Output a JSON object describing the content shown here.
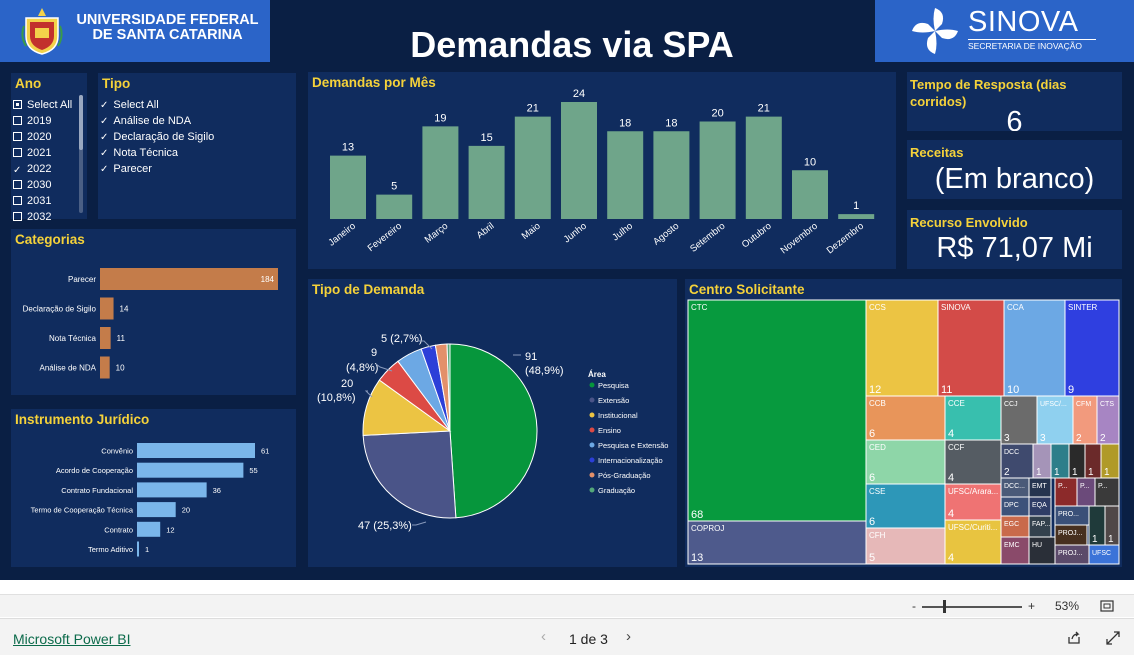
{
  "header": {
    "university": "UNIVERSIDADE FEDERAL DE SANTA CATARINA",
    "title": "Demandas via SPA",
    "brand": "SINOVA",
    "brand_sub": "SECRETARIA DE INOVAÇÃO"
  },
  "ano": {
    "title": "Ano",
    "items": [
      {
        "label": "Select All",
        "state": "partial"
      },
      {
        "label": "2019",
        "state": "off"
      },
      {
        "label": "2020",
        "state": "off"
      },
      {
        "label": "2021",
        "state": "off"
      },
      {
        "label": "2022",
        "state": "on"
      },
      {
        "label": "2030",
        "state": "off"
      },
      {
        "label": "2031",
        "state": "off"
      },
      {
        "label": "2032",
        "state": "off"
      }
    ]
  },
  "tipo": {
    "title": "Tipo",
    "items": [
      "Select All",
      "Análise de NDA",
      "Declaração de Sigilo",
      "Nota Técnica",
      "Parecer"
    ]
  },
  "demandas_mes": {
    "title": "Demandas por Mês",
    "months": [
      "Janeiro",
      "Fevereiro",
      "Março",
      "Abril",
      "Maio",
      "Junho",
      "Julho",
      "Agosto",
      "Setembro",
      "Outubro",
      "Novembro",
      "Dezembro"
    ],
    "values": [
      13,
      5,
      19,
      15,
      21,
      24,
      18,
      18,
      20,
      21,
      10,
      1
    ],
    "color": "#6fa58a"
  },
  "cards": {
    "tempo": {
      "title": "Tempo de Resposta (dias corridos)",
      "value": "6"
    },
    "receitas": {
      "title": "Receitas",
      "value": "(Em branco)"
    },
    "recurso": {
      "title": "Recurso Envolvido",
      "value": "R$ 71,07 Mi"
    }
  },
  "categorias": {
    "title": "Categorias",
    "labels": [
      "Parecer",
      "Declaração de Sigilo",
      "Nota Técnica",
      "Análise de NDA"
    ],
    "values": [
      184,
      14,
      11,
      10
    ],
    "color": "#c47c4a"
  },
  "instrumento": {
    "title": "Instrumento Jurídico",
    "labels": [
      "Convênio",
      "Acordo de Cooperação",
      "Contrato Fundacional",
      "Termo de Cooperação Técnica",
      "Contrato",
      "Termo Aditivo"
    ],
    "values": [
      61,
      55,
      36,
      20,
      12,
      1
    ],
    "color": "#7ab6ea"
  },
  "tipo_demanda": {
    "title": "Tipo de Demanda",
    "legend_title": "Área",
    "slices": [
      {
        "name": "Pesquisa",
        "value": 91,
        "label": "91",
        "pct": "(48,9%)",
        "color": "#06963c"
      },
      {
        "name": "Extensão",
        "value": 47,
        "label": "47 (25,3%)",
        "pct": "",
        "color": "#4a5488"
      },
      {
        "name": "Institucional",
        "value": 20,
        "label": "20",
        "pct": "(10,8%)",
        "color": "#ecc443"
      },
      {
        "name": "Ensino",
        "value": 9,
        "label": "9",
        "pct": "(4,8%)",
        "color": "#dc4a45"
      },
      {
        "name": "Pesquisa e Extensão",
        "value": 9,
        "label": "",
        "pct": "",
        "color": "#6ca8e4"
      },
      {
        "name": "Internacionalização",
        "value": 5,
        "label": "5 (2,7%)",
        "pct": "",
        "color": "#2c3fd8"
      },
      {
        "name": "Pós-Graduação",
        "value": 4,
        "label": "",
        "pct": "",
        "color": "#e3906a"
      },
      {
        "name": "Graduação",
        "value": 1,
        "label": "",
        "pct": "",
        "color": "#54a87a"
      }
    ]
  },
  "centro": {
    "title": "Centro Solicitante",
    "cells": [
      {
        "name": "CTC",
        "value": "68",
        "color": "#079a3e"
      },
      {
        "name": "COPROJ",
        "value": "13",
        "color": "#4e5a8c"
      },
      {
        "name": "CCS",
        "value": "12",
        "color": "#ecc443"
      },
      {
        "name": "SINOVA",
        "value": "11",
        "color": "#d34b48"
      },
      {
        "name": "CCA",
        "value": "10",
        "color": "#6ca8e4"
      },
      {
        "name": "SINTER",
        "value": "9",
        "color": "#2f3fe0"
      },
      {
        "name": "CCB",
        "value": "6",
        "color": "#e8955a"
      },
      {
        "name": "CCE",
        "value": "4",
        "color": "#38bfae"
      },
      {
        "name": "CCJ",
        "value": "3",
        "color": "#6b6b6b"
      },
      {
        "name": "UFSC/...",
        "value": "3",
        "color": "#8fd0ef"
      },
      {
        "name": "CFM",
        "value": "2",
        "color": "#f29a7d"
      },
      {
        "name": "CTS",
        "value": "2",
        "color": "#a785c3"
      },
      {
        "name": "CED",
        "value": "6",
        "color": "#8ed6a8"
      },
      {
        "name": "CCF",
        "value": "4",
        "color": "#555c63"
      },
      {
        "name": "DCC",
        "value": "2",
        "color": "#3f4a6e"
      },
      {
        "name": "CSE",
        "value": "6",
        "color": "#2d97b8"
      },
      {
        "name": "UFSC/Arara...",
        "value": "4",
        "color": "#ef7373"
      },
      {
        "name": "CFH",
        "value": "5",
        "color": "#e6b8b8"
      },
      {
        "name": "UFSC/Curiti...",
        "value": "4",
        "color": "#e8c440"
      },
      {
        "name": "DCC...",
        "value": "",
        "color": "#4a5a78"
      },
      {
        "name": "EMT",
        "value": "",
        "color": "#25344f"
      },
      {
        "name": "DPC",
        "value": "",
        "color": "#3d527a"
      },
      {
        "name": "EQA",
        "value": "",
        "color": "#2f3d66"
      },
      {
        "name": "EGC",
        "value": "",
        "color": "#c96a4b"
      },
      {
        "name": "FAP...",
        "value": "",
        "color": "#33414d"
      },
      {
        "name": "EMC",
        "value": "",
        "color": "#8a4a6a"
      },
      {
        "name": "HU",
        "value": "",
        "color": "#2a2f38"
      },
      {
        "name": "P...",
        "value": "",
        "color": "#8c2a2a"
      },
      {
        "name": "P...",
        "value": "",
        "color": "#6b4a7a"
      },
      {
        "name": "P...",
        "value": "",
        "color": "#3a3a3a"
      },
      {
        "name": "PRO...",
        "value": "",
        "color": "#3a5078"
      },
      {
        "name": "PROJ...",
        "value": "",
        "color": "#47301f"
      },
      {
        "name": "PROJ...",
        "value": "",
        "color": "#5b4a6a"
      },
      {
        "name": "UFSC",
        "value": "",
        "color": "#3b73d8"
      },
      {
        "name": "",
        "value": "1",
        "color": "#a594b8"
      },
      {
        "name": "",
        "value": "1",
        "color": "#2d7e8a"
      },
      {
        "name": "",
        "value": "1",
        "color": "#2a2a2a"
      },
      {
        "name": "",
        "value": "1",
        "color": "#6b2a2a"
      },
      {
        "name": "",
        "value": "1",
        "color": "#b09a28"
      },
      {
        "name": "",
        "value": "1",
        "color": "#1f3a3a"
      },
      {
        "name": "",
        "value": "1",
        "color": "#504848"
      }
    ]
  },
  "footer": {
    "zoom_minus": "-",
    "zoom_plus": "+",
    "zoom": "53%",
    "powerbi": "Microsoft Power BI",
    "page": "1 de 3"
  }
}
